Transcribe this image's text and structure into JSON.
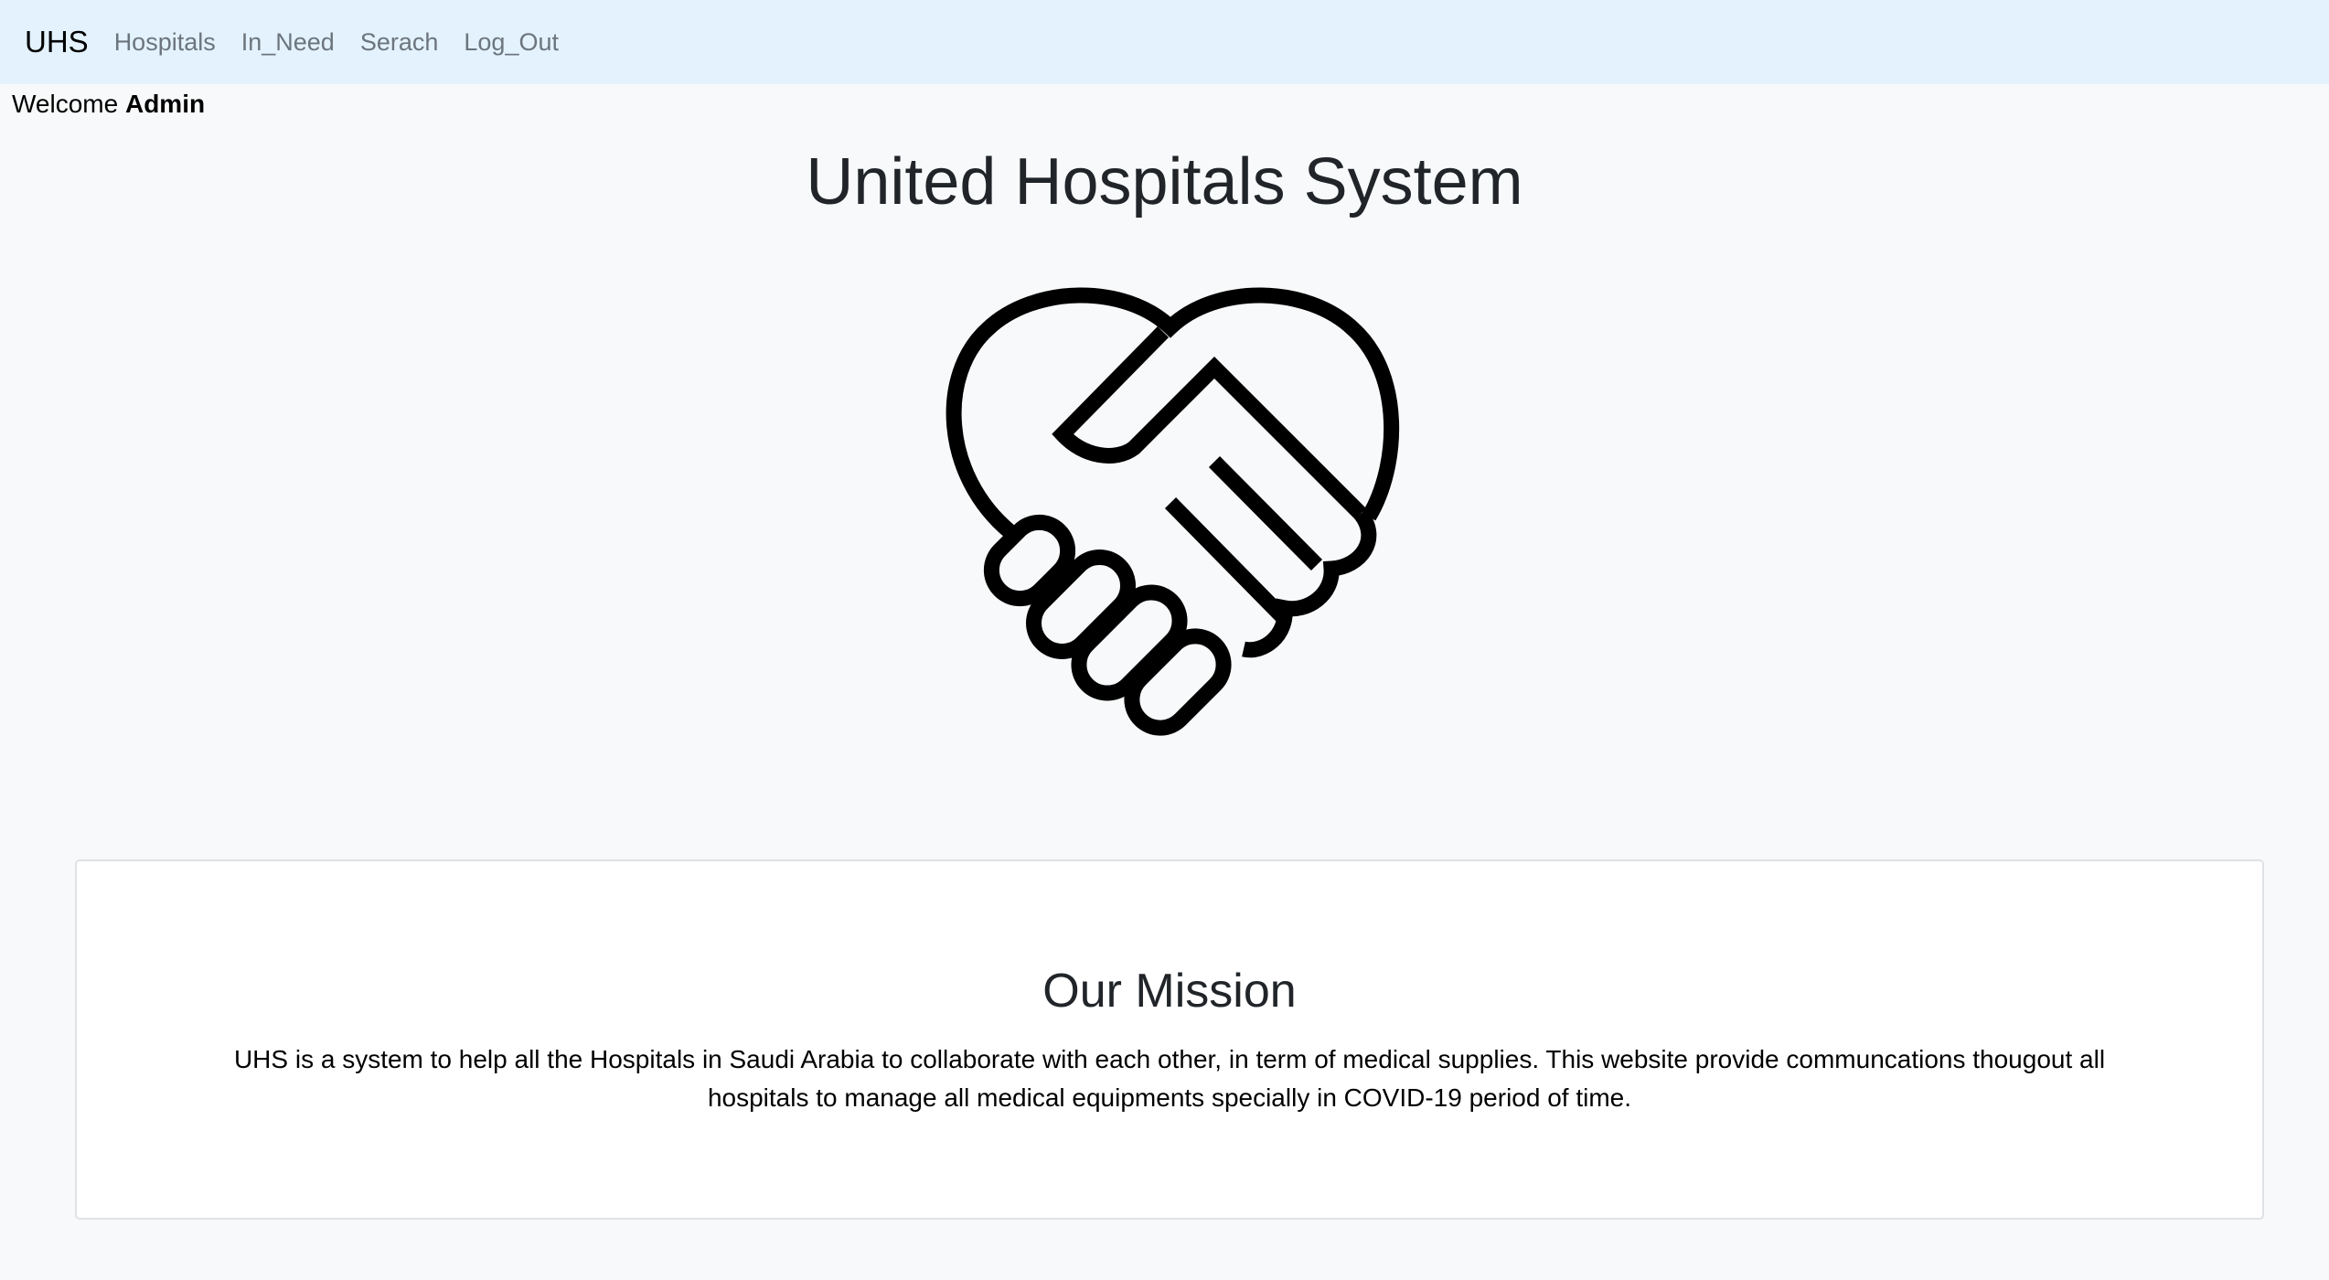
{
  "navbar": {
    "brand": "UHS",
    "links": [
      {
        "label": "Hospitals"
      },
      {
        "label": "In_Need"
      },
      {
        "label": "Serach"
      },
      {
        "label": "Log_Out"
      }
    ],
    "background": "#e3f2fd"
  },
  "welcome": {
    "prefix": "Welcome",
    "user": "Admin"
  },
  "hero": {
    "title": "United Hospitals System",
    "logo_icon": "heart-handshake-icon"
  },
  "mission": {
    "heading": "Our Mission",
    "text": "UHS is a system to help all the Hospitals in Saudi Arabia to collaborate with each other, in term of medical supplies. This website provide communcations thougout all hospitals to manage all medical equipments specially in COVID-19 period of time."
  }
}
